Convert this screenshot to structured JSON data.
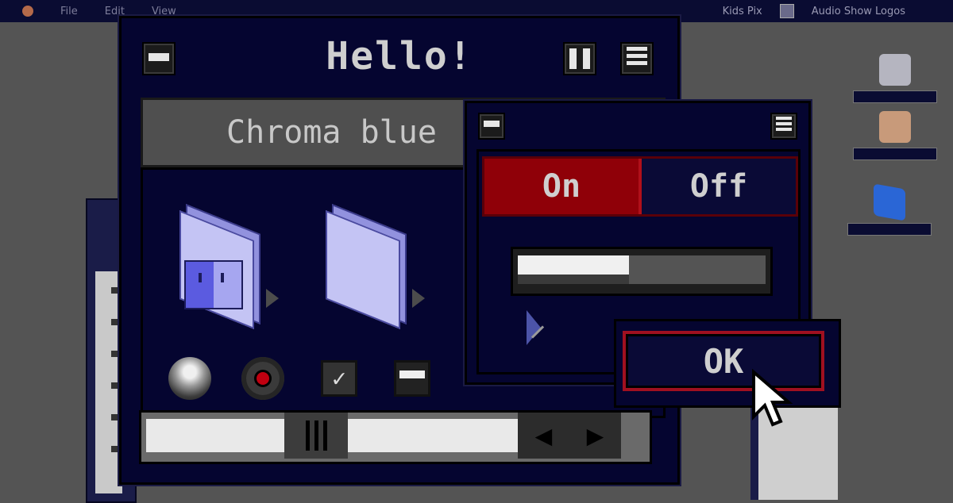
{
  "menubar": {
    "items": [
      "File",
      "Edit",
      "View"
    ],
    "right_items": [
      "Kids Pix",
      "Audio Show Logos"
    ]
  },
  "desktop_icons": [
    "icon-1",
    "icon-2",
    "icon-3"
  ],
  "main_window": {
    "title": "Hello!",
    "header_text": "Chroma blue "
  },
  "popup": {
    "toggle": {
      "on_label": "On",
      "off_label": "Off",
      "selected": "On"
    },
    "slider": {
      "value_fraction": 0.45
    }
  },
  "ok_button": {
    "label": "OK"
  },
  "scrollbar": {
    "thumb_position_fraction": 0.35
  },
  "colors": {
    "window_bg": "#050530",
    "accent_red": "#8f0008",
    "text": "#cfcfcf"
  }
}
